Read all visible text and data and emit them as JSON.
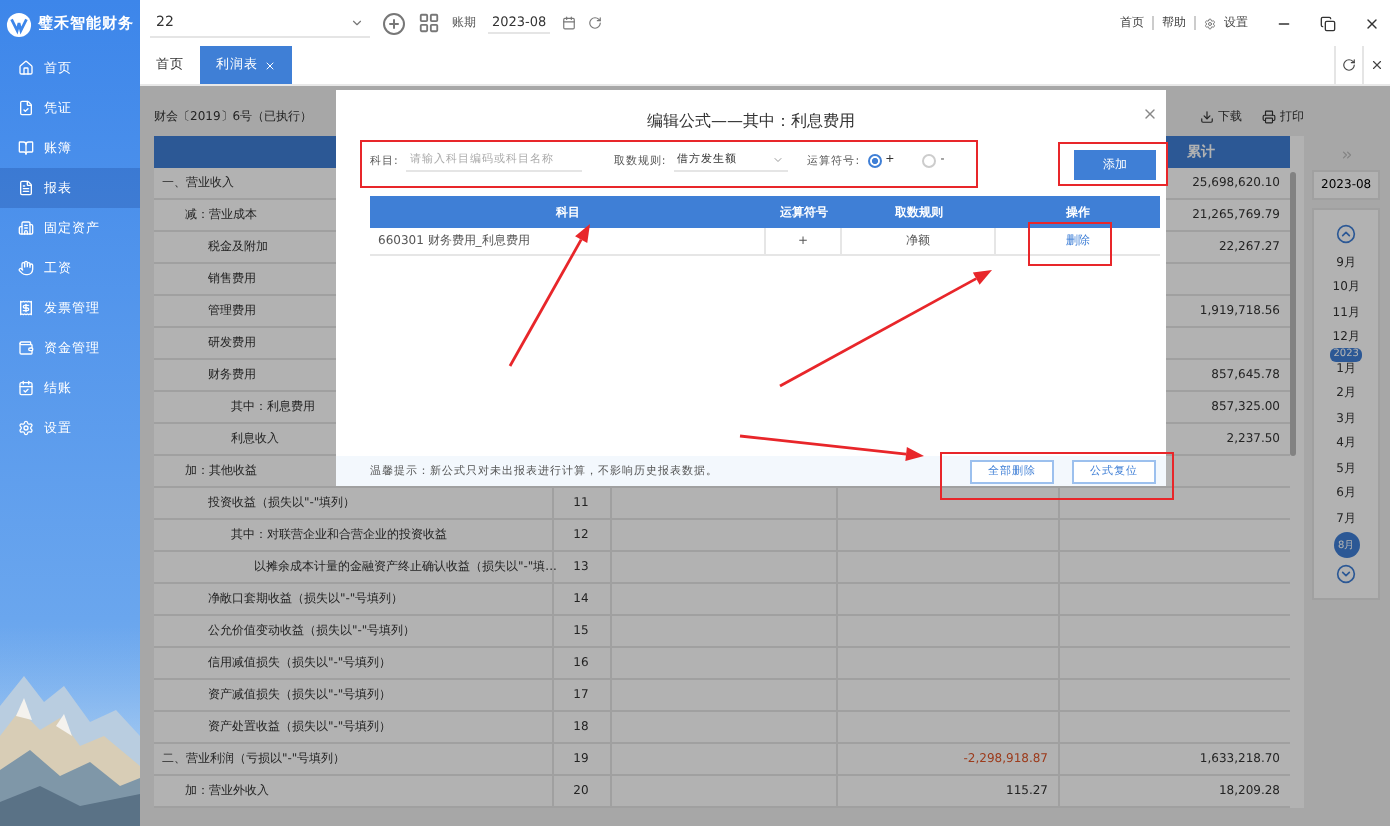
{
  "app": {
    "logo": "璧禾智能财务"
  },
  "sidebar": {
    "items": [
      {
        "label": "首页",
        "selected": false
      },
      {
        "label": "凭证",
        "selected": false
      },
      {
        "label": "账簿",
        "selected": false
      },
      {
        "label": "报表",
        "selected": true
      },
      {
        "label": "固定资产",
        "selected": false
      },
      {
        "label": "工资",
        "selected": false
      },
      {
        "label": "发票管理",
        "selected": false
      },
      {
        "label": "资金管理",
        "selected": false
      },
      {
        "label": "结账",
        "selected": false
      },
      {
        "label": "设置",
        "selected": false
      }
    ]
  },
  "top_bar": {
    "book": "22",
    "period_label": "账期",
    "period": "2023-08",
    "links": [
      "首页",
      "帮助",
      "设置"
    ]
  },
  "tabs": [
    {
      "label": "首页",
      "selected": false,
      "closable": false
    },
    {
      "label": "利润表",
      "selected": true,
      "closable": true
    }
  ],
  "report": {
    "standard": "财会〔2019〕6号（已执行）",
    "actions": [
      "下载",
      "打印"
    ],
    "total_header": "累计",
    "rows": [
      {
        "label": "一、营业收入",
        "total": "25,698,620.10",
        "children": [
          {
            "label": "减：营业成本",
            "total": "21,265,769.79",
            "children": [
              {
                "label": "税金及附加",
                "total": "22,267.27"
              },
              {
                "label": "销售费用"
              },
              {
                "label": "管理费用",
                "total": "1,919,718.56"
              },
              {
                "label": "研发费用"
              },
              {
                "label": "财务费用",
                "total": "857,645.78",
                "children": [
                  {
                    "label": "其中：利息费用",
                    "total": "857,325.00"
                  },
                  {
                    "label": "利息收入",
                    "total": "2,237.50"
                  }
                ]
              }
            ]
          },
          {
            "label": "加：其他收益",
            "children": [
              {
                "label": "投资收益（损失以\"-\"填列）",
                "line": "11",
                "children": [
                  {
                    "label": "其中：对联营企业和合营企业的投资收益",
                    "line": "12",
                    "children": [
                      {
                        "label": "以摊余成本计量的金融资产终止确认收益（损失以\"-\"填...",
                        "line": "13"
                      }
                    ]
                  }
                ]
              },
              {
                "label": "净敞口套期收益（损失以\"-\"号填列）",
                "line": "14"
              },
              {
                "label": "公允价值变动收益（损失以\"-\"号填列）",
                "line": "15"
              },
              {
                "label": "信用减值损失（损失以\"-\"号填列）",
                "line": "16"
              },
              {
                "label": "资产减值损失（损失以\"-\"号填列）",
                "line": "17"
              },
              {
                "label": "资产处置收益（损失以\"-\"号填列）",
                "line": "18"
              }
            ]
          }
        ]
      },
      {
        "label": "二、营业利润（亏损以\"-\"号填列）",
        "line": "19",
        "current": "-2,298,918.87",
        "negative": true,
        "total": "1,633,218.70",
        "children": [
          {
            "label": "加：营业外收入",
            "line": "20",
            "current": "115.27",
            "total": "18,209.28"
          }
        ]
      }
    ]
  },
  "month_picker": {
    "header": "2023-08",
    "items": [
      {
        "kind": "month",
        "label": "9月",
        "selected": false
      },
      {
        "kind": "month",
        "label": "10月",
        "selected": false
      },
      {
        "kind": "month",
        "label": "11月",
        "selected": false
      },
      {
        "kind": "month",
        "label": "12月",
        "selected": false
      },
      {
        "kind": "year",
        "label": "2023"
      },
      {
        "kind": "month",
        "label": "1月",
        "selected": false
      },
      {
        "kind": "month",
        "label": "2月",
        "selected": false
      },
      {
        "kind": "month",
        "label": "3月",
        "selected": false
      },
      {
        "kind": "month",
        "label": "4月",
        "selected": false
      },
      {
        "kind": "month",
        "label": "5月",
        "selected": false
      },
      {
        "kind": "month",
        "label": "6月",
        "selected": false
      },
      {
        "kind": "month",
        "label": "7月",
        "selected": false
      },
      {
        "kind": "month",
        "label": "8月",
        "selected": true
      }
    ]
  },
  "dialog": {
    "title": "编辑公式——其中：利息费用",
    "form": {
      "account_label": "科目:",
      "account_placeholder": "请输入科目编码或科目名称",
      "rule_label": "取数规则:",
      "rule_value": "借方发生额",
      "operator_label": "运算符号:",
      "operators": [
        {
          "label": "+",
          "selected": true
        },
        {
          "label": "-",
          "selected": false
        }
      ]
    },
    "add_button": "添加",
    "table": {
      "columns": [
        "科目",
        "运算符号",
        "取数规则",
        "操作"
      ],
      "rows": [
        {
          "account": "660301 财务费用_利息费用",
          "operator": "+",
          "rule": "净额",
          "action": "删除"
        }
      ]
    },
    "tip": "温馨提示：新公式只对未出报表进行计算，不影响历史报表数据。",
    "buttons": [
      "全部删除",
      "公式复位"
    ]
  }
}
